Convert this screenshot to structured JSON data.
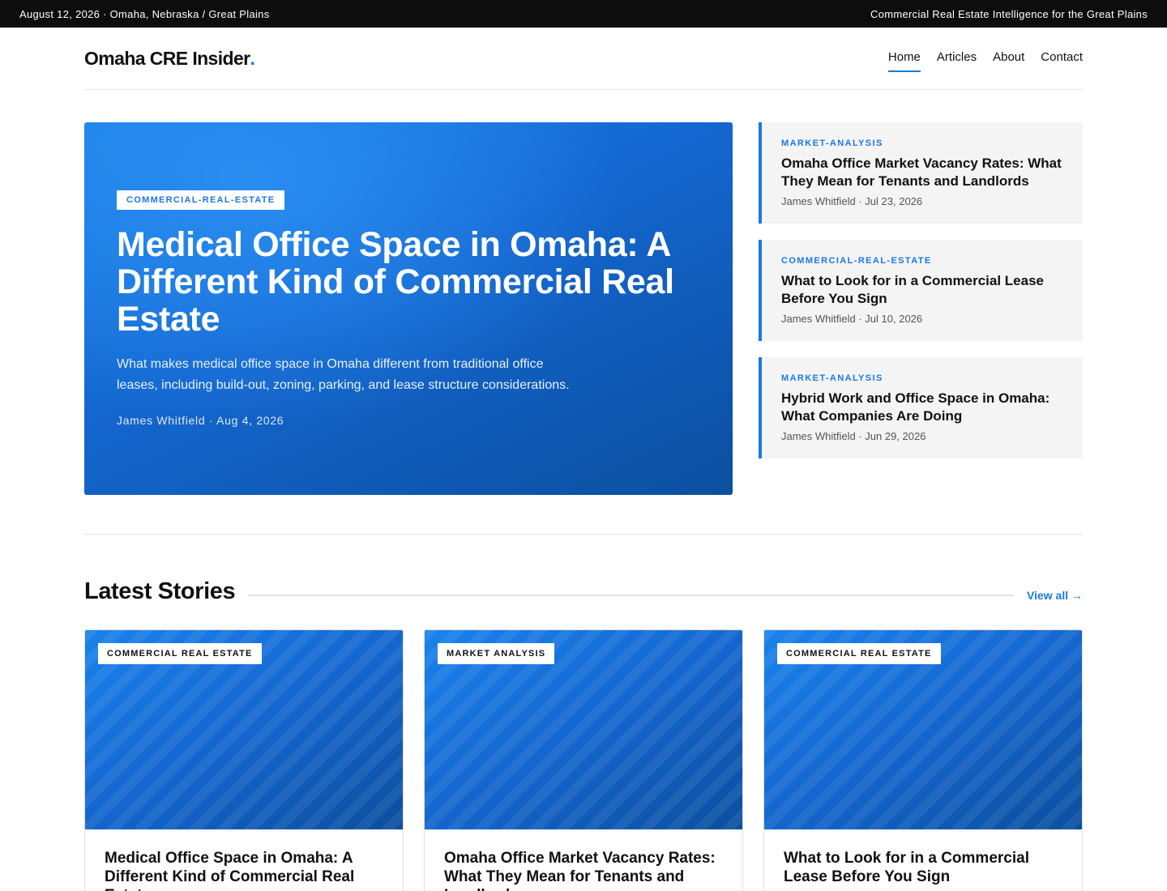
{
  "topbar": {
    "date_location": "August 12, 2026 · Omaha, Nebraska / Great Plains",
    "tagline": "Commercial Real Estate Intelligence for the Great Plains"
  },
  "header": {
    "logo_text": "Omaha CRE Insider",
    "logo_dot": ".",
    "nav": [
      {
        "label": "Home",
        "active": true
      },
      {
        "label": "Articles",
        "active": false
      },
      {
        "label": "About",
        "active": false
      },
      {
        "label": "Contact",
        "active": false
      }
    ]
  },
  "hero": {
    "category": "COMMERCIAL-REAL-ESTATE",
    "title": "Medical Office Space in Omaha: A Different Kind of Commercial Real Estate",
    "description": "What makes medical office space in Omaha different from traditional office leases, including build-out, zoning, parking, and lease structure considerations.",
    "meta": "James Whitfield · Aug 4, 2026"
  },
  "sidebar": [
    {
      "category": "MARKET-ANALYSIS",
      "title": "Omaha Office Market Vacancy Rates: What They Mean for Tenants and Landlords",
      "meta": "James Whitfield · Jul 23, 2026"
    },
    {
      "category": "COMMERCIAL-REAL-ESTATE",
      "title": "What to Look for in a Commercial Lease Before You Sign",
      "meta": "James Whitfield · Jul 10, 2026"
    },
    {
      "category": "MARKET-ANALYSIS",
      "title": "Hybrid Work and Office Space in Omaha: What Companies Are Doing",
      "meta": "James Whitfield · Jun 29, 2026"
    }
  ],
  "latest": {
    "heading": "Latest Stories",
    "view_all": "View all →",
    "cards": [
      {
        "tag": "COMMERCIAL REAL ESTATE",
        "title": "Medical Office Space in Omaha: A Different Kind of Commercial Real Estate"
      },
      {
        "tag": "MARKET ANALYSIS",
        "title": "Omaha Office Market Vacancy Rates: What They Mean for Tenants and Landlords"
      },
      {
        "tag": "COMMERCIAL REAL ESTATE",
        "title": "What to Look for in a Commercial Lease Before You Sign"
      }
    ]
  },
  "colors": {
    "accent": "#1a78e6",
    "topbar_bg": "#0d0d0d",
    "card_bg": "#f4f4f4"
  }
}
